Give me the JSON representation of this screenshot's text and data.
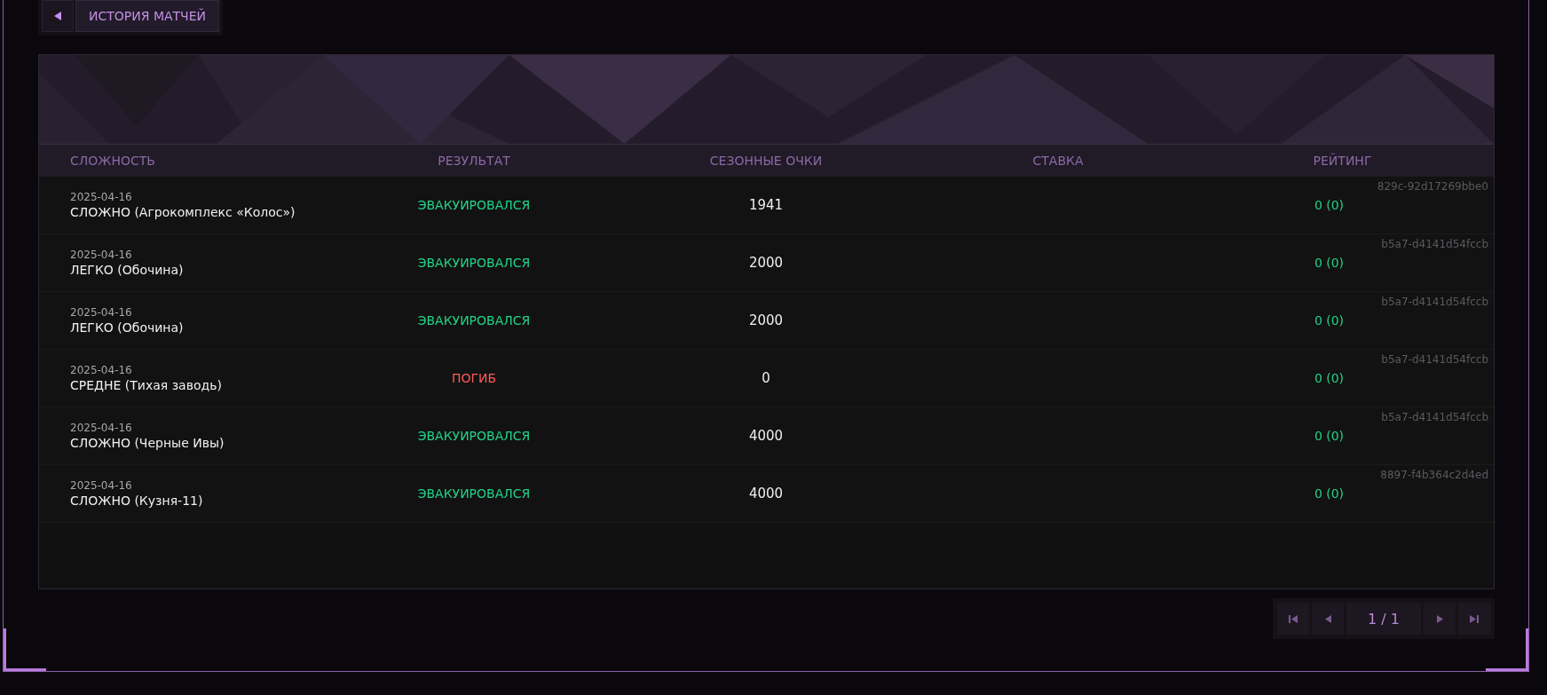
{
  "back_button": {
    "label": "ИСТОРИЯ МАТЧЕЙ"
  },
  "table": {
    "columns": [
      "СЛОЖНОСТЬ",
      "РЕЗУЛЬТАТ",
      "СЕЗОННЫЕ ОЧКИ",
      "СТАВКА",
      "РЕЙТИНГ"
    ],
    "rows": [
      {
        "date": "2025-04-16",
        "difficulty": "СЛОЖНО (Агрокомплекс «Колос»)",
        "result": "ЭВАКУИРОВАЛСЯ",
        "color": "#22d38a",
        "points": "1941",
        "rating": "0 (0)",
        "id": "829c-92d17269bbe0"
      },
      {
        "date": "2025-04-16",
        "difficulty": "ЛЕГКО (Обочина)",
        "result": "ЭВАКУИРОВАЛСЯ",
        "color": "#22d38a",
        "points": "2000",
        "rating": "0 (0)",
        "id": "b5a7-d4141d54fccb"
      },
      {
        "date": "2025-04-16",
        "difficulty": "ЛЕГКО (Обочина)",
        "result": "ЭВАКУИРОВАЛСЯ",
        "color": "#22d38a",
        "points": "2000",
        "rating": "0 (0)",
        "id": "b5a7-d4141d54fccb"
      },
      {
        "date": "2025-04-16",
        "difficulty": "СРЕДНЕ (Тихая заводь)",
        "result": "ПОГИБ",
        "color": "#ff5a5a",
        "points": "0",
        "rating": "0 (0)",
        "id": "b5a7-d4141d54fccb"
      },
      {
        "date": "2025-04-16",
        "difficulty": "СЛОЖНО (Черные Ивы)",
        "result": "ЭВАКУИРОВАЛСЯ",
        "color": "#22d38a",
        "points": "4000",
        "rating": "0 (0)",
        "id": "b5a7-d4141d54fccb"
      },
      {
        "date": "2025-04-16",
        "difficulty": "СЛОЖНО (Кузня-11)",
        "result": "ЭВАКУИРОВАЛСЯ",
        "color": "#22d38a",
        "points": "4000",
        "rating": "0 (0)",
        "id": "8897-f4b364c2d4ed"
      }
    ]
  },
  "pagination": {
    "page": "1 / 1"
  }
}
